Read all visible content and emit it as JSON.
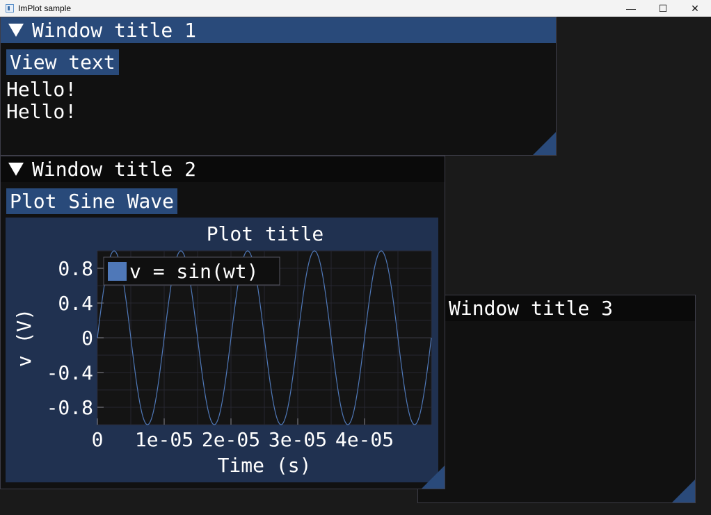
{
  "os_window": {
    "title": "ImPlot sample",
    "minimize_glyph": "—",
    "maximize_glyph": "☐",
    "close_glyph": "✕"
  },
  "window1": {
    "title": "Window title 1",
    "button_label": "View text",
    "lines": [
      "Hello!",
      "Hello!"
    ]
  },
  "window2": {
    "title": "Window title 2",
    "button_label": "Plot Sine Wave"
  },
  "window3": {
    "title": "Window title 3"
  },
  "colors": {
    "title_active": "#294a7a",
    "plot_bg": "#203150",
    "series_line": "#4f78b8",
    "legend_swatch": "#4f78b8"
  },
  "chart_data": {
    "type": "line",
    "title": "Plot title",
    "xlabel": "Time (s)",
    "ylabel": "v (V)",
    "xlim": [
      0,
      5e-05
    ],
    "ylim": [
      -1,
      1
    ],
    "xticks": [
      0,
      1e-05,
      2e-05,
      3e-05,
      4e-05
    ],
    "xtick_labels": [
      "0",
      "1e-05",
      "2e-05",
      "3e-05",
      "4e-05"
    ],
    "yticks": [
      0.8,
      0.4,
      0,
      -0.4,
      -0.8
    ],
    "ytick_labels": [
      "0.8",
      "0.4",
      "0",
      "-0.4",
      "-0.8"
    ],
    "grid": true,
    "legend_position": "top-left",
    "series": [
      {
        "name": "v = sin(wt)",
        "function": "sin",
        "amplitude": 1,
        "frequency_hz": 100000,
        "x_start": 0,
        "x_end": 5e-05
      }
    ]
  }
}
